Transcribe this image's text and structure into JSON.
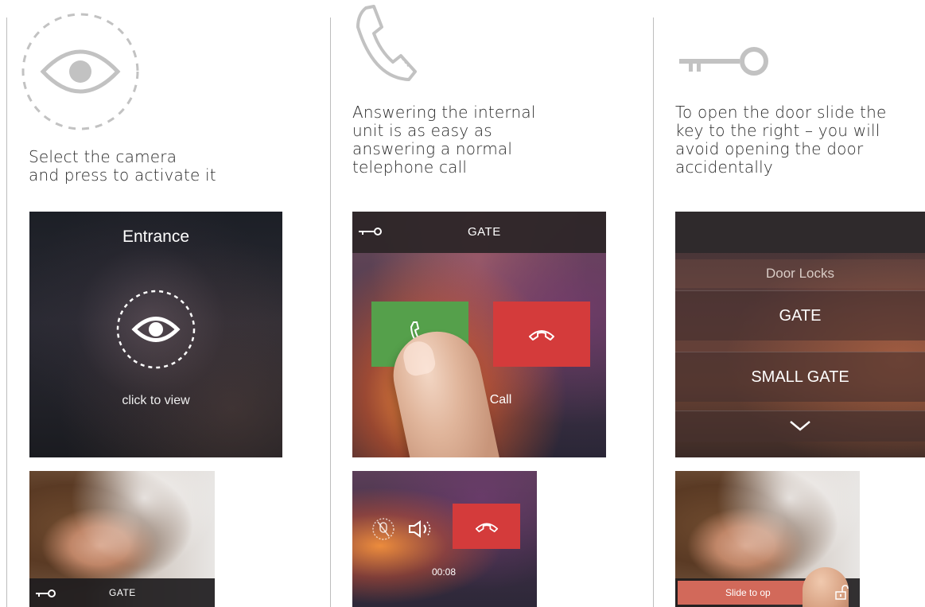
{
  "columns": [
    {
      "icon": "eye-icon",
      "caption": [
        "Select the camera",
        "and press to activate it"
      ]
    },
    {
      "icon": "phone-icon",
      "caption": [
        "Answering the internal",
        "unit is as easy as",
        "answering a normal",
        "telephone call"
      ]
    },
    {
      "icon": "key-icon",
      "caption": [
        "To open the door slide the",
        "key to the right – you will",
        "avoid opening the door",
        "accidentally"
      ]
    }
  ],
  "screens": {
    "entrance": {
      "title": "Entrance",
      "hint": "click to view"
    },
    "face_call": {
      "bar_label": "GATE"
    },
    "incoming_call": {
      "bar_label": "GATE",
      "status": "ning Call"
    },
    "in_call": {
      "timer": "00:08"
    },
    "door_locks": {
      "header": "Door Locks",
      "items": [
        "GATE",
        "SMALL GATE"
      ]
    },
    "slide_unlock": {
      "slider_label": "Slide to op"
    }
  },
  "colors": {
    "answer": "#55a04b",
    "reject": "#d43b3b",
    "slider": "#d2695a",
    "divider": "#bdbdbd"
  }
}
